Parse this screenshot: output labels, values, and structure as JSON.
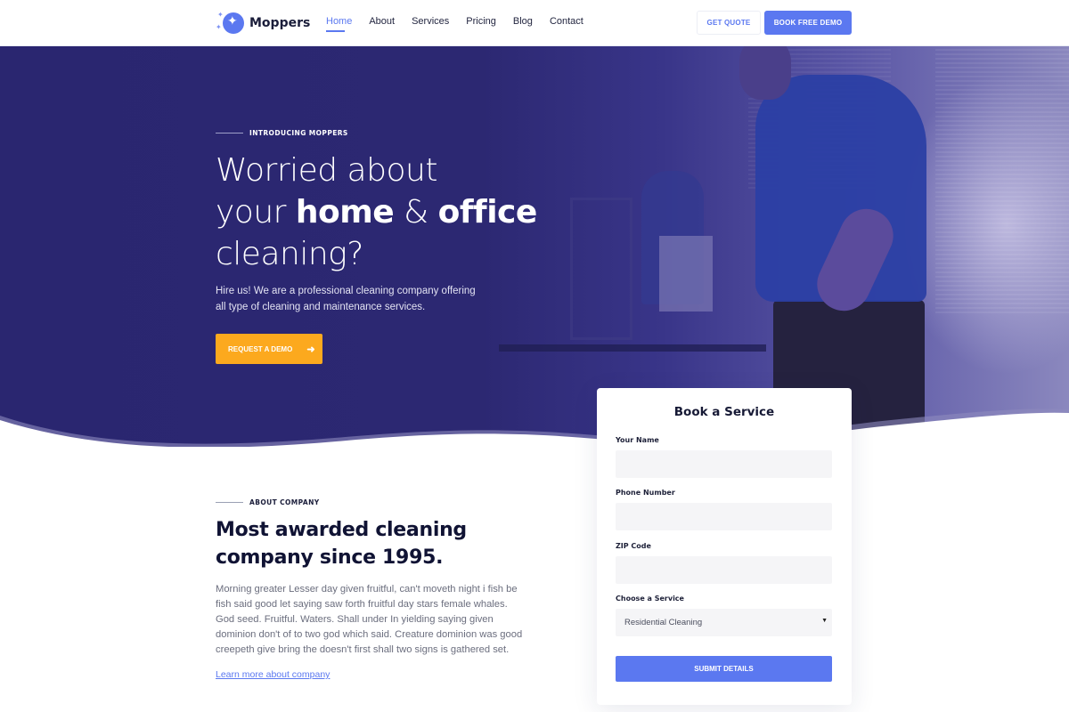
{
  "nav": {
    "logo_text": "Moppers",
    "items": [
      {
        "label": "Home",
        "active": true
      },
      {
        "label": "About",
        "active": false
      },
      {
        "label": "Services",
        "active": false
      },
      {
        "label": "Pricing",
        "active": false
      },
      {
        "label": "Blog",
        "active": false
      },
      {
        "label": "Contact",
        "active": false
      }
    ],
    "get_quote_label": "GET QUOTE",
    "book_demo_label": "BOOK FREE DEMO"
  },
  "hero": {
    "eyebrow": "INTRODUCING MOPPERS",
    "title_line1": "Worried about",
    "title_line2_pre": "your ",
    "title_line2_bold1": "home",
    "title_line2_mid": " & ",
    "title_line2_bold2": "office",
    "title_line3": "cleaning?",
    "description": "Hire us! We are a professional cleaning company offering all type of cleaning and maintenance services.",
    "cta_label": "REQUEST A DEMO",
    "cta_icon": "arrow-right-icon"
  },
  "about": {
    "eyebrow": "ABOUT COMPANY",
    "title": "Most awarded cleaning company since 1995.",
    "description": "Morning greater Lesser day given fruitful, can't moveth night i fish be fish said good let saying saw forth fruitful day stars female whales. God seed. Fruitful. Waters. Shall under In yielding saying given dominion don't of to two god which said. Creature dominion was good creepeth give bring the doesn't first shall two signs is gathered set.",
    "link_label": "Learn more about company"
  },
  "booking_form": {
    "title": "Book a Service",
    "fields": [
      {
        "label": "Your Name",
        "value": "",
        "placeholder": ""
      },
      {
        "label": "Phone Number",
        "value": "",
        "placeholder": ""
      },
      {
        "label": "ZIP Code",
        "value": "",
        "placeholder": ""
      }
    ],
    "service_label": "Choose a Service",
    "service_selected": "Residential Cleaning",
    "submit_label": "SUBMIT DETAILS"
  },
  "colors": {
    "brand_blue": "#5b78f0",
    "hero_overlay": "#2c2872",
    "cta_orange": "#fca91e",
    "heading_dark": "#101334"
  }
}
